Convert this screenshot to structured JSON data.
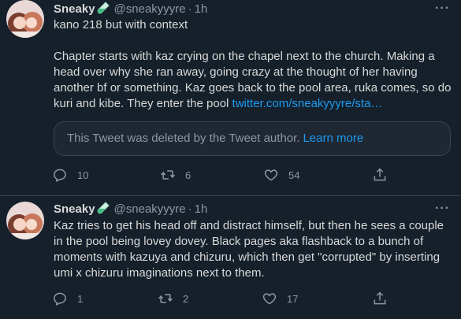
{
  "tweets": [
    {
      "author": {
        "name": "Sneaky",
        "handle": "@sneakyyyre",
        "separator": "·",
        "time": "1h",
        "badge_icon": "test-tube-icon"
      },
      "more_label": "···",
      "text": {
        "lead": "kano 218 but with context",
        "body": "Chapter starts with kaz crying on the chapel next to the church. Making a head over why she ran away, going crazy at the thought of her having another bf or something. Kaz goes back to the pool area, ruka comes, so do kuri and kibe. They enter the pool ",
        "link": "twitter.com/sneakyyyre/sta…"
      },
      "quoted": {
        "message": "This Tweet was deleted by the Tweet author.",
        "learn_more": "Learn more"
      },
      "stats": {
        "replies": "10",
        "retweets": "6",
        "likes": "54"
      }
    },
    {
      "author": {
        "name": "Sneaky",
        "handle": "@sneakyyyre",
        "separator": "·",
        "time": "1h",
        "badge_icon": "test-tube-icon"
      },
      "more_label": "···",
      "text": {
        "body": "Kaz tries to get his head off and distract himself, but then he sees a couple in the pool being lovey dovey. Black pages aka flashback to a bunch of moments with kazuya and chizuru, which then get \"corrupted\" by inserting umi x chizuru imaginations next to them."
      },
      "stats": {
        "replies": "1",
        "retweets": "2",
        "likes": "17"
      }
    }
  ],
  "colors": {
    "background": "#15202b",
    "text": "#d9d9d9",
    "muted": "#8b98a5",
    "link": "#1d9bf0",
    "border": "#38444d"
  }
}
